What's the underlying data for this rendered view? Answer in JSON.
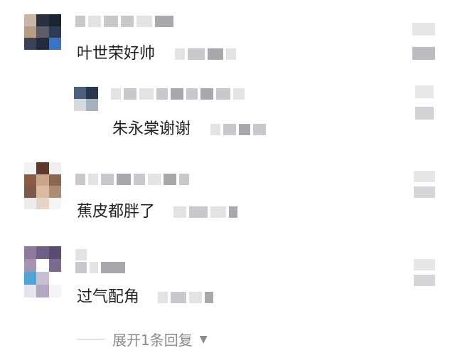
{
  "comments": [
    {
      "text": "叶世荣好帅"
    },
    {
      "text": "朱永棠谢谢"
    },
    {
      "text": "蕉皮都胖了"
    },
    {
      "text": "过气配角"
    }
  ],
  "expand": {
    "label": "展开1条回复",
    "icon": "caret-down-icon"
  },
  "colors": {
    "text": "#1f1f1f",
    "muted": "#8a8a8a",
    "blur": "#c9c9cd"
  }
}
